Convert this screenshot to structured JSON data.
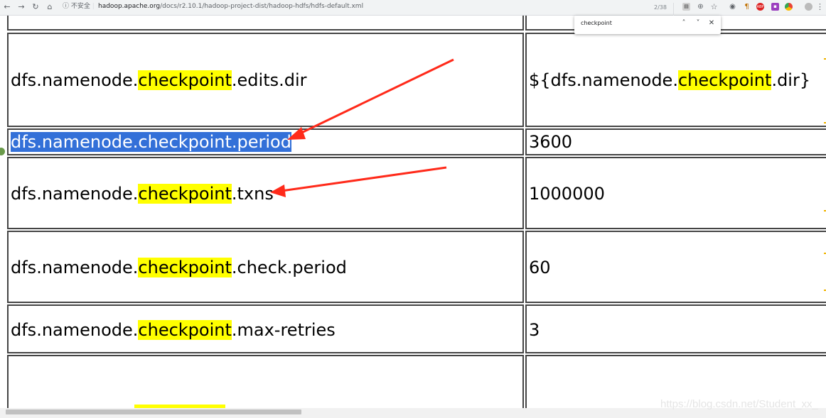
{
  "browser": {
    "security_label": "不安全",
    "url_host": "hadoop.apache.org",
    "url_path": "/docs/r2.10.1/hadoop-project-dist/hadoop-hdfs/hdfs-default.xml",
    "nav_icons": [
      "back-icon",
      "forward-icon",
      "reload-icon",
      "home-icon"
    ],
    "extension_icons": [
      "page-translate-icon",
      "zoom-icon",
      "bookmark-star-icon",
      "camera-icon",
      "paragraph-icon",
      "abp-icon",
      "extension-icon",
      "chrome-icon",
      "menu-icon"
    ],
    "abp_badge": "ABP"
  },
  "find_bar": {
    "query": "checkpoint",
    "count": "2/38"
  },
  "table": {
    "highlight_word": "checkpoint",
    "rows": [
      {
        "prefix": "dfs.namenode.",
        "suffix": ".edits.dir",
        "value_prefix": "${dfs.namenode.",
        "value_suffix": ".dir}"
      },
      {
        "full": "dfs.namenode.checkpoint.period",
        "value": "3600"
      },
      {
        "prefix": "dfs.namenode.",
        "suffix": ".txns",
        "value": "1000000"
      },
      {
        "prefix": "dfs.namenode.",
        "suffix": ".check.period",
        "value": "60"
      },
      {
        "prefix": "dfs.namenode.",
        "suffix": ".max-retries",
        "value": "3"
      }
    ]
  },
  "annotation_color": "#ff2a1a",
  "highlight_color": "#ffff00",
  "selection_color": "#3370d8",
  "watermark": "https://blog.csdn.net/Student_xx_"
}
